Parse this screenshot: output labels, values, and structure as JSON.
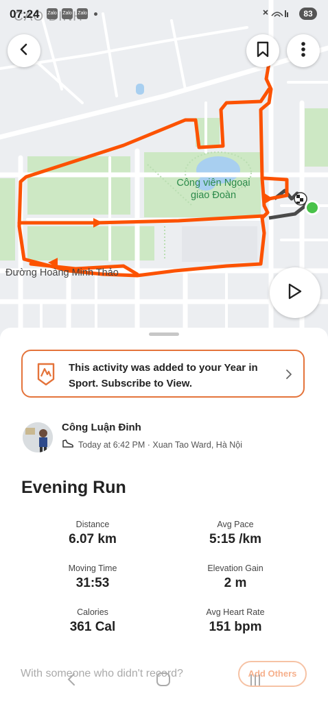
{
  "status_bar": {
    "time": "07:24",
    "overlay_text": "CAO ĐINH",
    "battery": "83",
    "notif_1": "Zalo",
    "notif_2": "Zalo",
    "notif_3": "Zalo"
  },
  "map": {
    "park_label_line1": "Công viên Ngoại",
    "park_label_line2": "giao Đoàn",
    "road_label": "Đường Hoàng Minh Thảo"
  },
  "banner": {
    "text": "This activity was added to your Year in Sport. Subscribe to View."
  },
  "athlete": {
    "name": "Công Luận Đinh",
    "meta": "Today at 6:42 PM · Xuan Tao Ward, Hà Nội"
  },
  "activity": {
    "title": "Evening Run"
  },
  "stats": [
    {
      "label": "Distance",
      "value": "6.07 km"
    },
    {
      "label": "Avg Pace",
      "value": "5:15 /km"
    },
    {
      "label": "Moving Time",
      "value": "31:53"
    },
    {
      "label": "Elevation Gain",
      "value": "2 m"
    },
    {
      "label": "Calories",
      "value": "361 Cal"
    },
    {
      "label": "Avg Heart Rate",
      "value": "151 bpm"
    }
  ],
  "footer": {
    "prompt": "With someone who didn't record?",
    "add_others": "Add Others"
  },
  "colors": {
    "route": "#fc5200",
    "accent": "#e4733a",
    "park": "#cde8c4",
    "water": "#a8cff0",
    "start_dot": "#49c24a"
  },
  "icons": {
    "back": "chevron-left-icon",
    "bookmark": "bookmark-icon",
    "more": "more-vertical-icon",
    "play": "play-icon",
    "year_in_sport": "strava-badge-icon",
    "shoe": "shoe-icon"
  }
}
